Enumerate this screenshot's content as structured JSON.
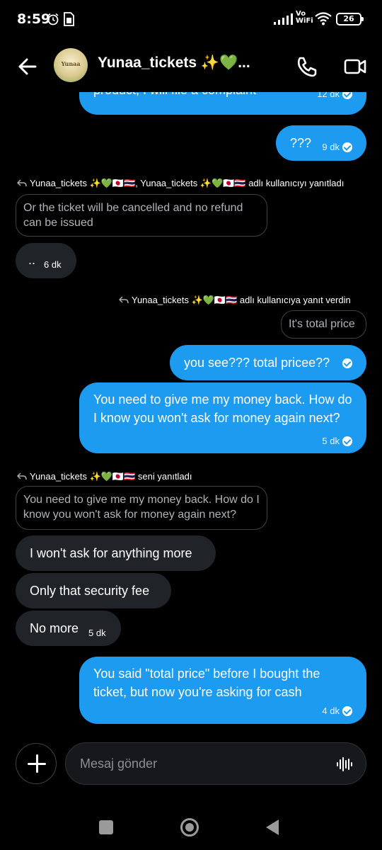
{
  "status_bar": {
    "time": "8:59",
    "network_label": "Vo\nWiFi",
    "battery": "26"
  },
  "header": {
    "contact_name": "Yunaa_tickets ✨💚...",
    "avatar_text": "Yunaa"
  },
  "messages": {
    "m1_text": "product, I will file a complaint",
    "m1_time": "12 dk",
    "m2_text": "???",
    "m2_time": "9 dk",
    "reply1_header": "Yunaa_tickets ✨💚🇯🇵🇹🇭, Yunaa_tickets ✨💚🇯🇵🇹🇭 adlı kullanıcıyı yanıtladı",
    "reply1_quote": "Or the ticket will be cancelled and no refund can be issued",
    "m3_text": "..",
    "m3_time": "6 dk",
    "reply2_header": "Yunaa_tickets ✨💚🇯🇵🇹🇭 adlı kullanıcıya yanıt verdin",
    "reply2_quote": "It's total price",
    "m4_text": "you see??? total pricee??",
    "m5_text": "You need to give me my money back. How do I know you won't ask for money again next?",
    "m5_time": "5 dk",
    "reply3_header": "Yunaa_tickets ✨💚🇯🇵🇹🇭 seni yanıtladı",
    "reply3_quote": "You need to give me my money back. How do I know you won't ask for money again next?",
    "m6_text": "I won't ask for anything more",
    "m7_text": "Only that security fee",
    "m8_text": "No more",
    "m8_time": "5 dk",
    "m9_text": "You said \"total price\" before I bought the ticket, but now you're asking for cash",
    "m9_time": "4 dk"
  },
  "composer": {
    "placeholder": "Mesaj gönder"
  },
  "colors": {
    "outgoing_bubble": "#1d9bf0",
    "incoming_bubble": "#202327",
    "background": "#000000"
  },
  "icons": [
    "back-arrow-icon",
    "phone-icon",
    "video-icon",
    "plus-icon",
    "voice-wave-icon",
    "check-icon",
    "reply-arrow-icon"
  ]
}
